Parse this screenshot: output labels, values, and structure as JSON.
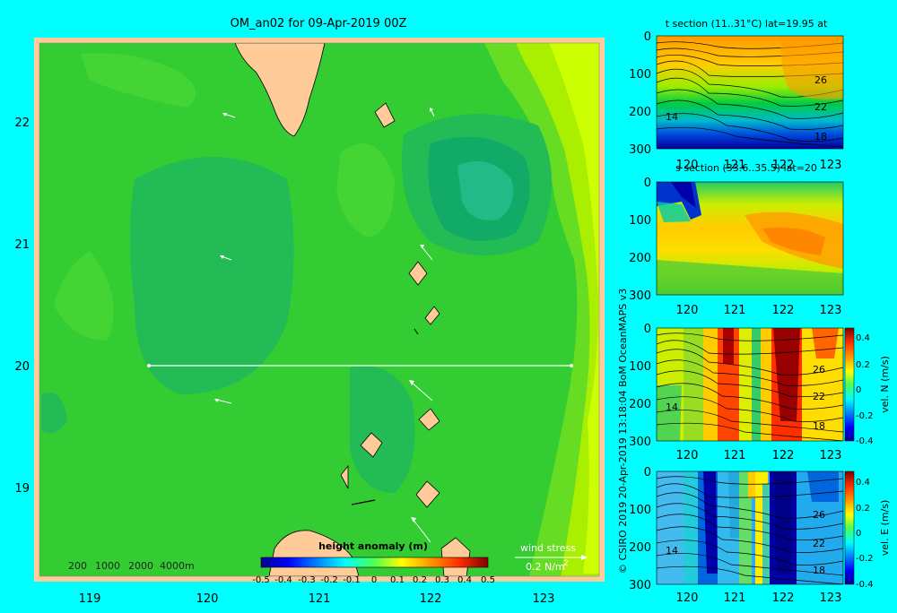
{
  "main_map": {
    "title": "OM_an02 for 09-Apr-2019 00Z",
    "x_ticks": [
      "119",
      "120",
      "121",
      "122",
      "123"
    ],
    "y_ticks": [
      "22",
      "21",
      "20",
      "19"
    ],
    "depth_legend": [
      "200",
      "1000",
      "2000",
      "4000m"
    ],
    "colorbar_title": "height anomaly (m)",
    "colorbar_ticks": [
      "-0.5",
      "-0.4",
      "-0.3",
      "-0.2",
      "-0.1",
      "0",
      "0.1",
      "0.2",
      "0.3",
      "0.4",
      "0.5"
    ],
    "wind_label": "wind stress",
    "wind_scale": "0.2 N/m",
    "wind_scale_sup": "2"
  },
  "credit": "© CSIRO 2019   20-Apr-2019 13:18:04 BoM OceanMAPS v3",
  "panels": [
    {
      "title": "t section (11..31°C) lat=19.95 at",
      "y_ticks": [
        "0",
        "100",
        "200",
        "300"
      ],
      "x_ticks": [
        "120",
        "121",
        "122",
        "123"
      ],
      "contour_labels": [
        "26",
        "22",
        "18",
        "14"
      ]
    },
    {
      "title": "s section (33.6..35.5) lat=20",
      "y_ticks": [
        "0",
        "100",
        "200",
        "300"
      ],
      "x_ticks": [
        "120",
        "121",
        "122",
        "123"
      ]
    },
    {
      "title": "",
      "y_ticks": [
        "0",
        "100",
        "200",
        "300"
      ],
      "x_ticks": [
        "120",
        "121",
        "122",
        "123"
      ],
      "contour_labels": [
        "26",
        "22",
        "18",
        "14"
      ],
      "colorbar_label": "vel. N (m/s)",
      "colorbar_ticks": [
        "0.4",
        "0.2",
        "0",
        "-0.2",
        "-0.4"
      ]
    },
    {
      "title": "",
      "y_ticks": [
        "0",
        "100",
        "200",
        "300"
      ],
      "x_ticks": [
        "120",
        "121",
        "122",
        "123"
      ],
      "contour_labels": [
        "26",
        "22",
        "18",
        "14"
      ],
      "colorbar_label": "vel. E (m/s)",
      "colorbar_ticks": [
        "0.4",
        "0.2",
        "0",
        "-0.2",
        "-0.4"
      ]
    }
  ],
  "chart_data": [
    {
      "type": "heatmap",
      "title": "OM_an02 for 09-Apr-2019 00Z",
      "xlim": [
        118.5,
        123.5
      ],
      "ylim": [
        18.3,
        22.7
      ],
      "x_ticks": [
        119,
        120,
        121,
        122,
        123
      ],
      "y_ticks": [
        22,
        21,
        20,
        19
      ],
      "colorbar": {
        "title": "height anomaly (m)",
        "range": [
          -0.5,
          0.5
        ]
      },
      "section_line": {
        "lat": 20,
        "lon_range": [
          119.5,
          123.2
        ]
      },
      "wind_stress_scale": "0.2 N/m2"
    },
    {
      "type": "heatmap",
      "title": "t section (11..31°C) lat=19.95 at",
      "xlim": [
        119.6,
        123.2
      ],
      "ylim": [
        300,
        0
      ],
      "contours": [
        26,
        22,
        18,
        14
      ]
    },
    {
      "type": "heatmap",
      "title": "s section (33.6..35.5) lat=20",
      "xlim": [
        119.6,
        123.2
      ],
      "ylim": [
        300,
        0
      ]
    },
    {
      "type": "heatmap",
      "variable": "vel. N (m/s)",
      "xlim": [
        119.6,
        123.2
      ],
      "ylim": [
        300,
        0
      ],
      "colorbar_range": [
        -0.4,
        0.4
      ]
    },
    {
      "type": "heatmap",
      "variable": "vel. E (m/s)",
      "xlim": [
        119.6,
        123.2
      ],
      "ylim": [
        300,
        0
      ],
      "colorbar_range": [
        -0.4,
        0.4
      ]
    }
  ]
}
